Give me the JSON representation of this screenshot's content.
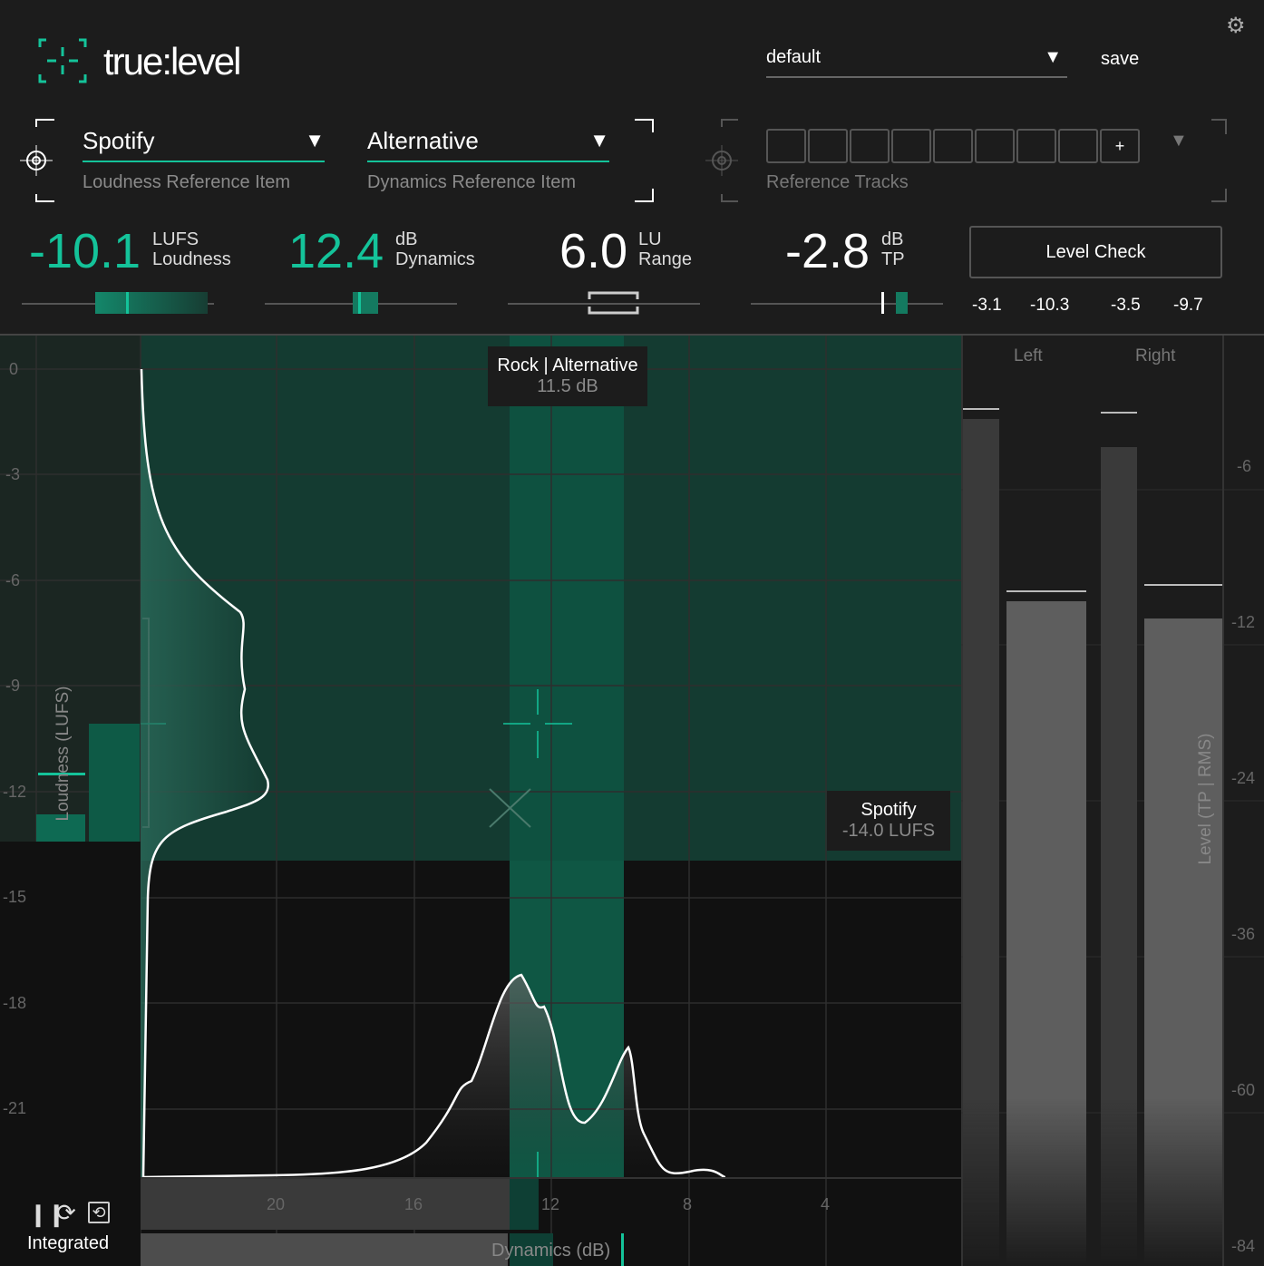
{
  "app": {
    "title": "true:level"
  },
  "preset": {
    "value": "default",
    "save_label": "save"
  },
  "loudness_ref": {
    "value": "Spotify",
    "label": "Loudness Reference Item"
  },
  "dynamics_ref": {
    "value": "Alternative",
    "label": "Dynamics Reference Item"
  },
  "reference_tracks": {
    "label": "Reference Tracks",
    "add_label": "+",
    "slots": 8
  },
  "readouts": [
    {
      "value": "-10.1",
      "unit": "LUFS",
      "label": "Loudness"
    },
    {
      "value": "12.4",
      "unit": "dB",
      "label": "Dynamics"
    },
    {
      "value": "6.0",
      "unit": "LU",
      "label": "Range"
    },
    {
      "value": "-2.8",
      "unit": "dB",
      "label": "TP"
    }
  ],
  "level_check": {
    "label": "Level Check",
    "values": [
      "-3.1",
      "-10.3",
      "-3.5",
      "-9.7"
    ]
  },
  "plot": {
    "y_ticks": [
      "0",
      "-3",
      "-6",
      "-9",
      "-12",
      "-15",
      "-18",
      "-21"
    ],
    "x_ticks": [
      "20",
      "16",
      "12",
      "8",
      "4"
    ],
    "ylabel": "Loudness (LUFS)",
    "xlabel": "Dynamics (dB)",
    "dyn_tooltip": {
      "title": "Rock | Alternative",
      "value": "11.5 dB"
    },
    "loud_tooltip": {
      "title": "Spotify",
      "value": "-14.0 LUFS"
    }
  },
  "meters": {
    "left_label": "Left",
    "right_label": "Right",
    "axis_label": "Level (TP | RMS)",
    "ticks": [
      "-6",
      "-12",
      "-24",
      "-36",
      "-60",
      "-84"
    ]
  },
  "transport": {
    "mode_label": "Integrated"
  },
  "colors": {
    "accent": "#14c39a",
    "background": "#1c1c1c"
  }
}
